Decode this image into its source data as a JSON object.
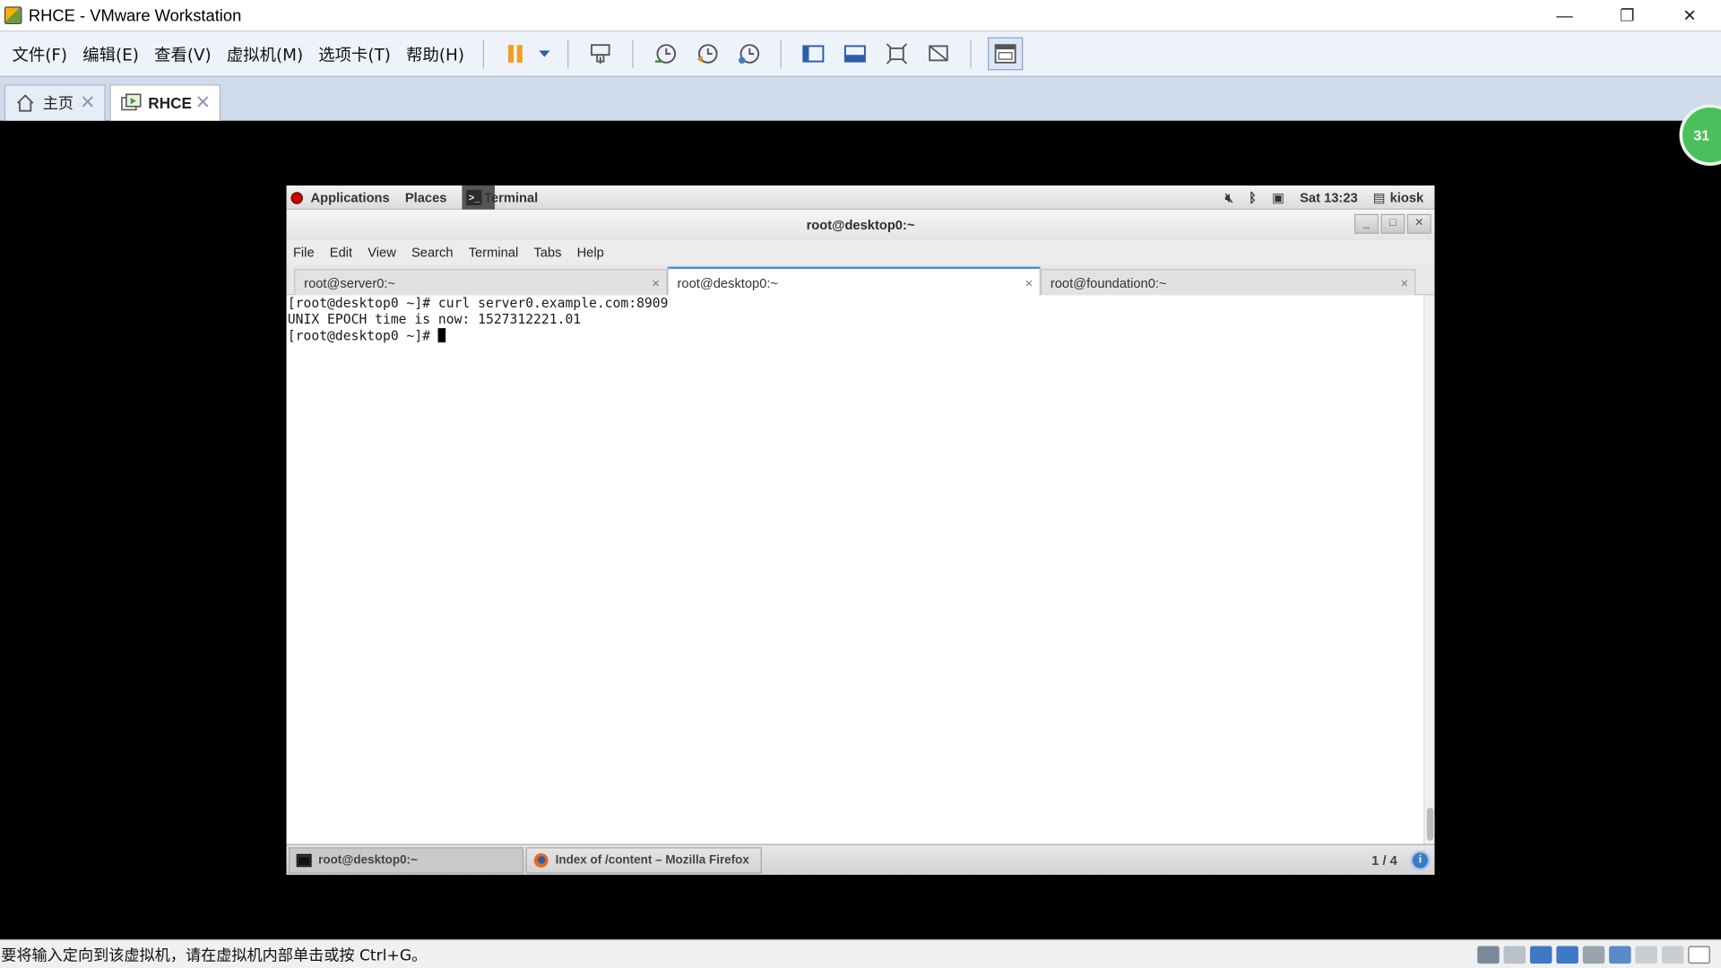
{
  "window": {
    "title": "RHCE - VMware Workstation",
    "controls": {
      "minimize": "—",
      "restore": "❐",
      "close": "✕"
    }
  },
  "menu": [
    "文件(F)",
    "编辑(E)",
    "查看(V)",
    "虚拟机(M)",
    "选项卡(T)",
    "帮助(H)"
  ],
  "tabs": {
    "home_label": "主页",
    "vm_label": "RHCE",
    "close_glyph": "✕"
  },
  "badge": "31",
  "gnome_top": {
    "applications": "Applications",
    "places": "Places",
    "terminal": "Terminal",
    "clock": "Sat 13:23",
    "user": "kiosk",
    "icons": [
      "volume-muted-icon",
      "bluetooth-icon",
      "network-icon",
      "user-icon"
    ]
  },
  "terminal": {
    "window_title": "root@desktop0:~",
    "menu": [
      "File",
      "Edit",
      "View",
      "Search",
      "Terminal",
      "Tabs",
      "Help"
    ],
    "tabs": [
      {
        "label": "root@server0:~"
      },
      {
        "label": "root@desktop0:~"
      },
      {
        "label": "root@foundation0:~"
      }
    ],
    "tab_close": "×",
    "lines": [
      "[root@desktop0 ~]# curl server0.example.com:8909",
      "UNIX EPOCH time is now: 1527312221.01",
      "[root@desktop0 ~]# "
    ]
  },
  "taskbar": {
    "items": [
      {
        "label": "root@desktop0:~"
      },
      {
        "label": "Index of /content – Mozilla Firefox"
      }
    ],
    "pager": "1 / 4",
    "info": "i"
  },
  "status": {
    "message": "要将输入定向到该虚拟机，请在虚拟机内部单击或按 Ctrl+G。"
  }
}
